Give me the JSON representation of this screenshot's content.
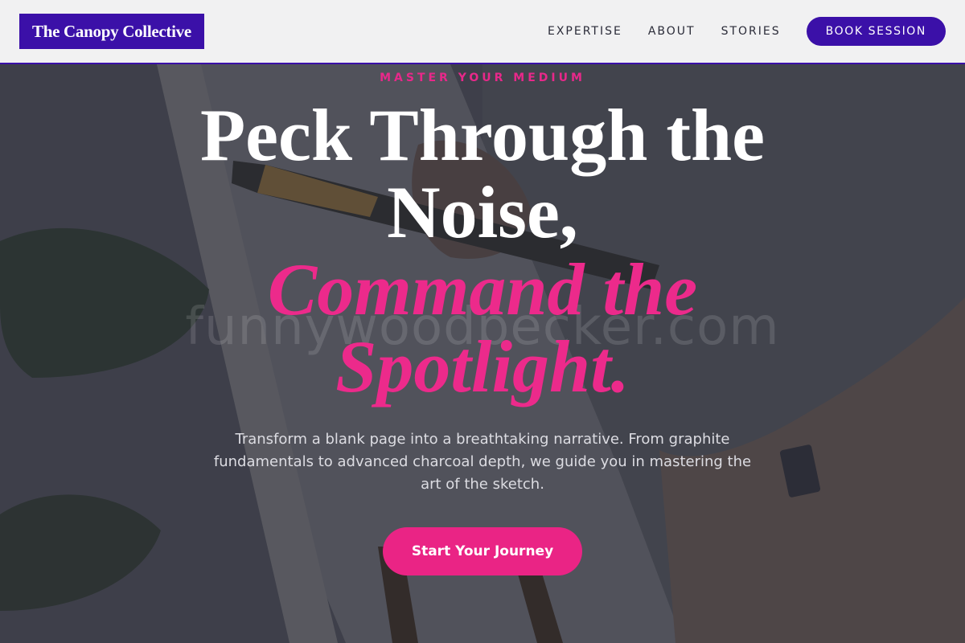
{
  "brand": {
    "name": "The Canopy Collective"
  },
  "nav": {
    "links": [
      "EXPERTISE",
      "ABOUT",
      "STORIES"
    ],
    "cta_label": "BOOK SESSION"
  },
  "hero": {
    "eyebrow": "MASTER YOUR MEDIUM",
    "headline_line1": "Peck Through the Noise,",
    "headline_accent": "Command the Spotlight.",
    "subtext": "Transform a blank page into a breathtaking narrative. From graphite fundamentals to advanced charcoal depth, we guide you in mastering the art of the sketch.",
    "cta_label": "Start Your Journey",
    "watermark": "funnywoodpecker.com"
  },
  "colors": {
    "brand_purple": "#3b10a8",
    "accent_pink": "#ec2a8b",
    "header_bg": "#f1f1f2",
    "overlay": "#3a3b45"
  },
  "icons": {
    "background": "painting-easel-brush-image"
  }
}
